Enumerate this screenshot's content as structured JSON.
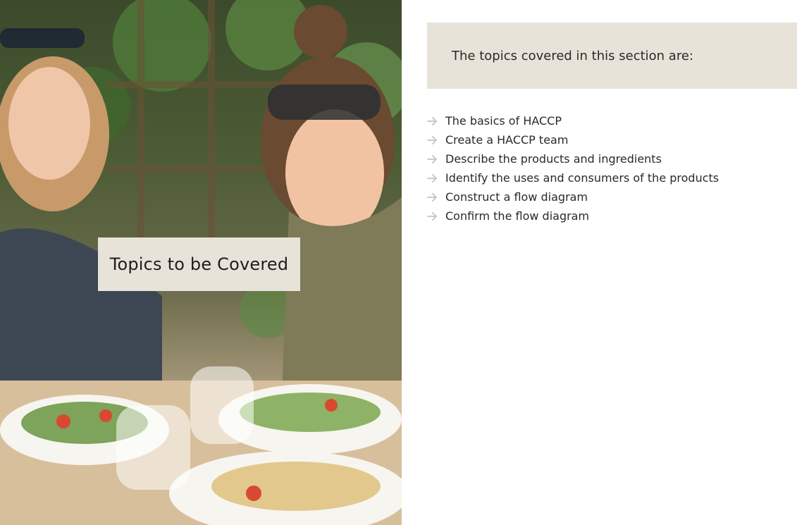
{
  "hero": {
    "title": "Topics to be Covered",
    "image_description_icon": "photo-icon"
  },
  "intro": {
    "text": "The topics covered in this section are:"
  },
  "topics": [
    {
      "label": "The basics of HACCP"
    },
    {
      "label": "Create a HACCP team"
    },
    {
      "label": "Describe the products and ingredients"
    },
    {
      "label": "Identify the uses and consumers of the products"
    },
    {
      "label": "Construct a flow diagram"
    },
    {
      "label": "Confirm the flow diagram"
    }
  ],
  "colors": {
    "accent_box": "#e8e3d9",
    "arrow": "#cfc9bd",
    "text": "#2a2a2a"
  }
}
